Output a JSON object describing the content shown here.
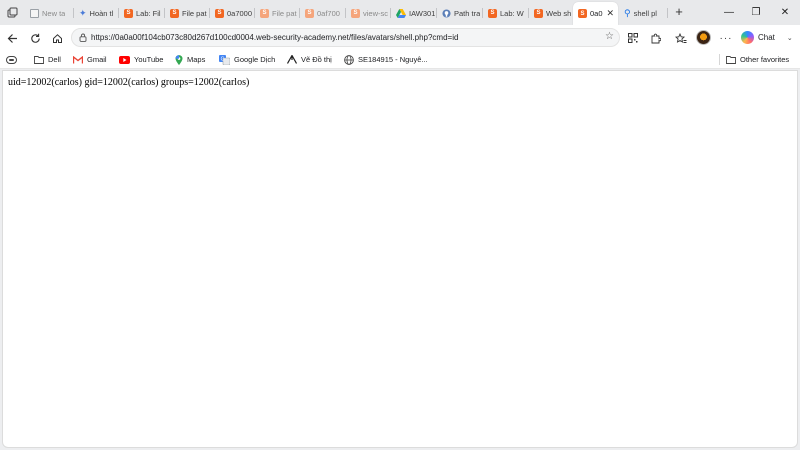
{
  "tabs": [
    {
      "label": "New ta",
      "favicon": "page-icon",
      "faded": true
    },
    {
      "label": "Hoàn tl",
      "favicon": "sparkle-icon"
    },
    {
      "label": "Lab: Fil",
      "favicon": "portswigger-icon"
    },
    {
      "label": "File pat",
      "favicon": "portswigger-icon"
    },
    {
      "label": "0a7000",
      "favicon": "portswigger-icon"
    },
    {
      "label": "File pat",
      "favicon": "portswigger-icon",
      "faded": true
    },
    {
      "label": "0af700",
      "favicon": "portswigger-icon",
      "faded": true
    },
    {
      "label": "view-sc",
      "favicon": "portswigger-icon",
      "faded": true
    },
    {
      "label": "IAW301",
      "favicon": "drive-icon"
    },
    {
      "label": "Path tra",
      "favicon": "github-icon"
    },
    {
      "label": "Lab: W",
      "favicon": "portswigger-icon"
    },
    {
      "label": "Web sh",
      "favicon": "portswigger-icon"
    },
    {
      "label": "0a0",
      "favicon": "portswigger-icon",
      "active": true
    },
    {
      "label": "shell pl",
      "favicon": "search-icon"
    }
  ],
  "address_bar": {
    "url": "https://0a0a00f104cb073c80d267d100cd0004.web-security-academy.net/files/avatars/shell.php?cmd=id"
  },
  "toolbar": {
    "chat_label": "Chat"
  },
  "bookmarks": [
    {
      "label": "Dell",
      "icon": "folder-icon"
    },
    {
      "label": "Gmail",
      "icon": "gmail-icon"
    },
    {
      "label": "YouTube",
      "icon": "youtube-icon"
    },
    {
      "label": "Maps",
      "icon": "maps-icon"
    },
    {
      "label": "Google Dịch",
      "icon": "translate-icon"
    },
    {
      "label": "Vẽ Đồ thị",
      "icon": "graph-icon"
    },
    {
      "label": "SE184915 - Nguyê...",
      "icon": "globe-icon"
    }
  ],
  "other_favorites": "Other favorites",
  "page": {
    "output": "uid=12002(carlos) gid=12002(carlos) groups=12002(carlos)"
  },
  "colors": {
    "portswigger_orange": "#f26722",
    "active_tab_bg": "#ffffff",
    "tabstrip_bg": "#e8e9eb"
  }
}
